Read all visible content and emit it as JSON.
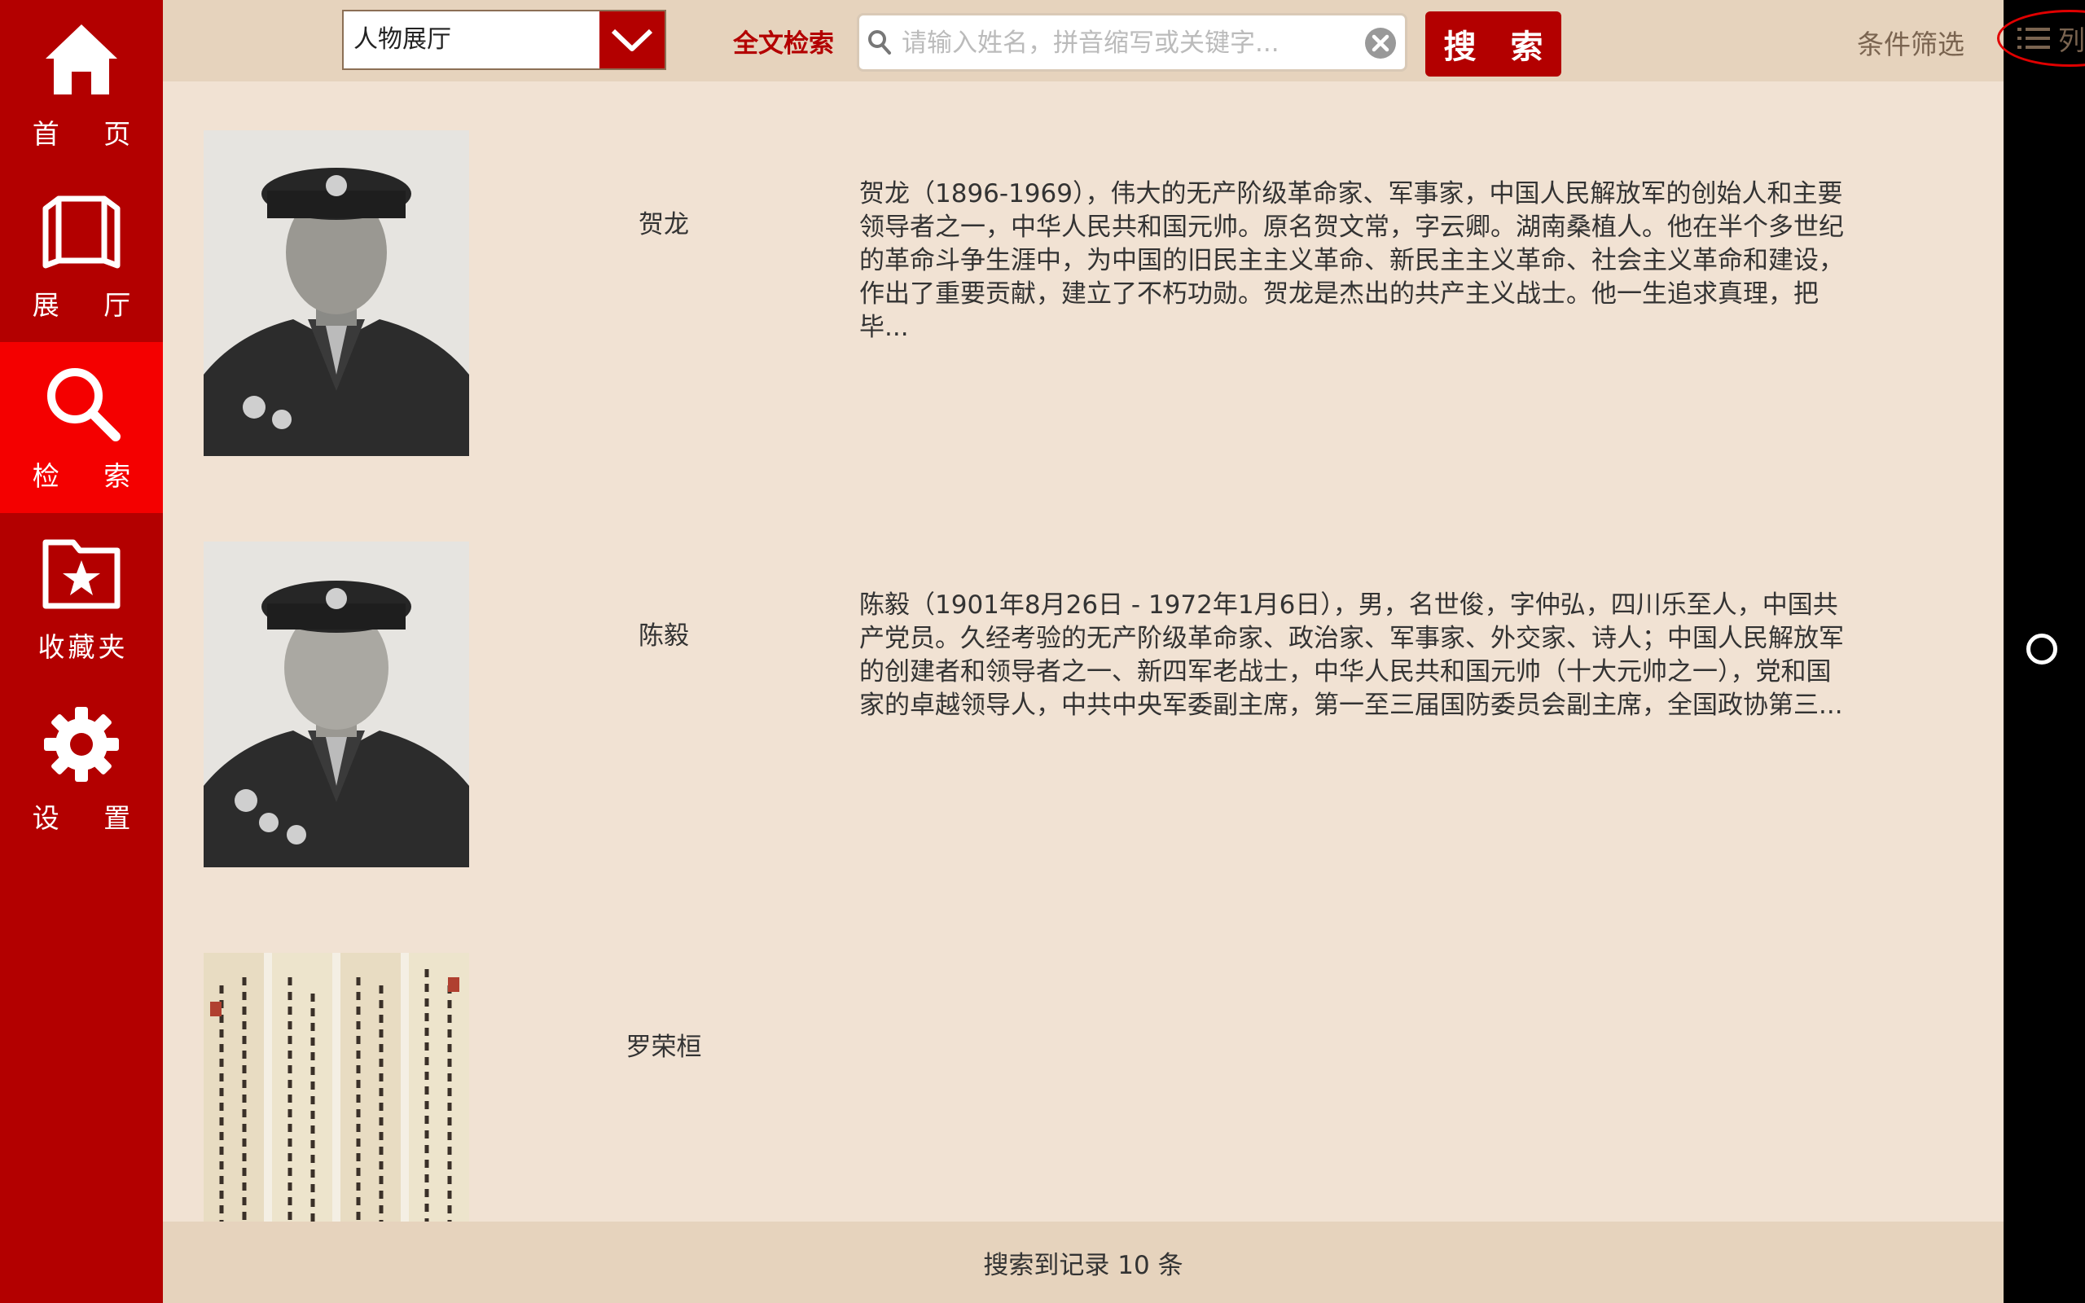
{
  "sidebar": {
    "items": [
      {
        "label": "首 页",
        "icon": "home-icon"
      },
      {
        "label": "展 厅",
        "icon": "book-icon"
      },
      {
        "label": "检 索",
        "icon": "search-icon",
        "active": true
      },
      {
        "label": "收藏夹",
        "icon": "star-folder-icon"
      },
      {
        "label": "设 置",
        "icon": "gear-icon"
      }
    ]
  },
  "toolbar": {
    "hall_select_value": "人物展厅",
    "fulltext_label": "全文检索",
    "search_placeholder": "请输入姓名，拼音缩写或关键字...",
    "search_button": "搜 索",
    "filter_label": "条件筛选",
    "list_label": "列表"
  },
  "results": [
    {
      "name": "贺龙",
      "description": "贺龙（1896-1969），伟大的无产阶级革命家、军事家，中国人民解放军的创始人和主要领导者之一，中华人民共和国元帅。原名贺文常，字云卿。湖南桑植人。他在半个多世纪的革命斗争生涯中，为中国的旧民主主义革命、新民主主义革命、社会主义革命和建设，作出了重要贡献，建立了不朽功勋。贺龙是杰出的共产主义战士。他一生追求真理，把毕..."
    },
    {
      "name": "陈毅",
      "description": "陈毅（1901年8月26日 - 1972年1月6日），男，名世俊，字仲弘，四川乐至人，中国共产党员。久经考验的无产阶级革命家、政治家、军事家、外交家、诗人；中国人民解放军的创建者和领导者之一、新四军老战士，中华人民共和国元帅（十大元帅之一），党和国家的卓越领导人，中共中央军委副主席，第一至三届国防委员会副主席，全国政协第三..."
    },
    {
      "name": "罗荣桓",
      "description": ""
    }
  ],
  "footer": {
    "status": "搜索到记录 10 条"
  },
  "colors": {
    "sidebar": "#b30000",
    "sidebar_active": "#f40000",
    "accent": "#b30000",
    "content_bg": "#f1e2d3",
    "bar_bg": "#e6d3bd"
  }
}
